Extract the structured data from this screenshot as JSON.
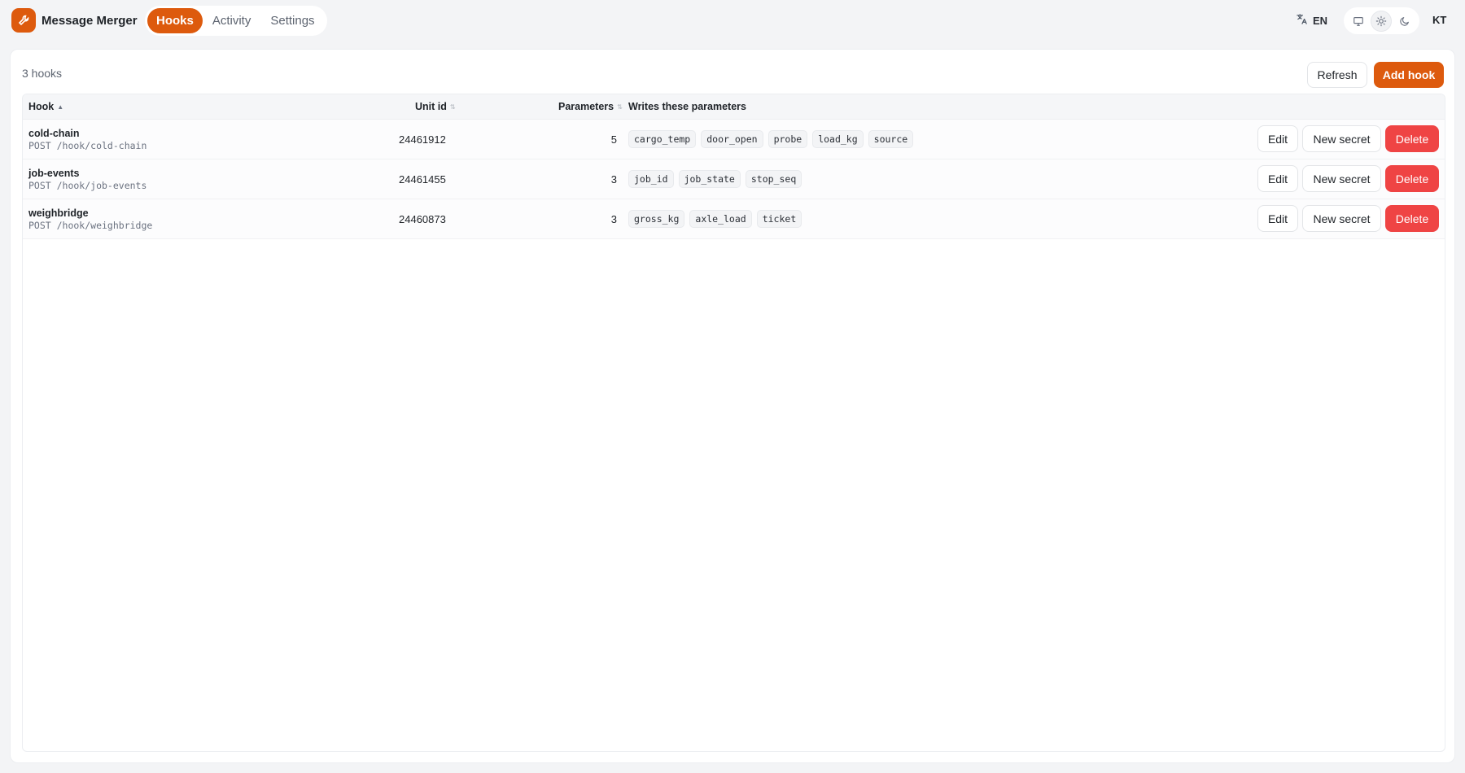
{
  "app": {
    "name": "Message Merger",
    "logo_icon": "wrench-icon",
    "accent_color": "#dd5a0d"
  },
  "nav": {
    "tabs": [
      {
        "label": "Hooks",
        "active": true
      },
      {
        "label": "Activity",
        "active": false
      },
      {
        "label": "Settings",
        "active": false
      }
    ]
  },
  "header": {
    "language_icon": "translate-icon",
    "language": "EN",
    "theme_options": [
      "monitor-icon",
      "sun-icon",
      "moon-icon"
    ],
    "theme_selected": "sun-icon",
    "user_initials": "KT"
  },
  "toolbar": {
    "count_label": "3 hooks",
    "refresh_label": "Refresh",
    "add_label": "Add hook"
  },
  "table": {
    "columns": {
      "hook": "Hook",
      "unit_id": "Unit id",
      "parameters": "Parameters",
      "writes": "Writes these parameters"
    },
    "sorted_by": "Hook",
    "rows": [
      {
        "name": "cold-chain",
        "path": "POST /hook/cold-chain",
        "unit_id": "24461912",
        "parameters": "5",
        "writes": [
          "cargo_temp",
          "door_open",
          "probe",
          "load_kg",
          "source"
        ]
      },
      {
        "name": "job-events",
        "path": "POST /hook/job-events",
        "unit_id": "24461455",
        "parameters": "3",
        "writes": [
          "job_id",
          "job_state",
          "stop_seq"
        ]
      },
      {
        "name": "weighbridge",
        "path": "POST /hook/weighbridge",
        "unit_id": "24460873",
        "parameters": "3",
        "writes": [
          "gross_kg",
          "axle_load",
          "ticket"
        ]
      }
    ],
    "row_actions": {
      "edit_label": "Edit",
      "secret_label": "New secret",
      "delete_label": "Delete",
      "delete_color": "#ef4444"
    }
  }
}
